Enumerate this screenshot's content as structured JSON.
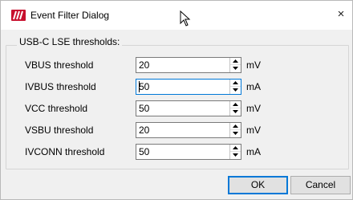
{
  "window": {
    "title": "Event Filter Dialog",
    "close_glyph": "×",
    "accent_color": "#0078d7",
    "logo_color": "#c8102e"
  },
  "group": {
    "title": "USB-C LSE thresholds:",
    "rows": [
      {
        "label": "VBUS threshold",
        "value": "20",
        "unit": "mV"
      },
      {
        "label": "IVBUS threshold",
        "value": "50",
        "unit": "mA"
      },
      {
        "label": "VCC threshold",
        "value": "50",
        "unit": "mV"
      },
      {
        "label": "VSBU threshold",
        "value": "20",
        "unit": "mV"
      },
      {
        "label": "IVCONN threshold",
        "value": "50",
        "unit": "mA"
      }
    ]
  },
  "buttons": {
    "ok_label": "OK",
    "cancel_label": "Cancel"
  }
}
